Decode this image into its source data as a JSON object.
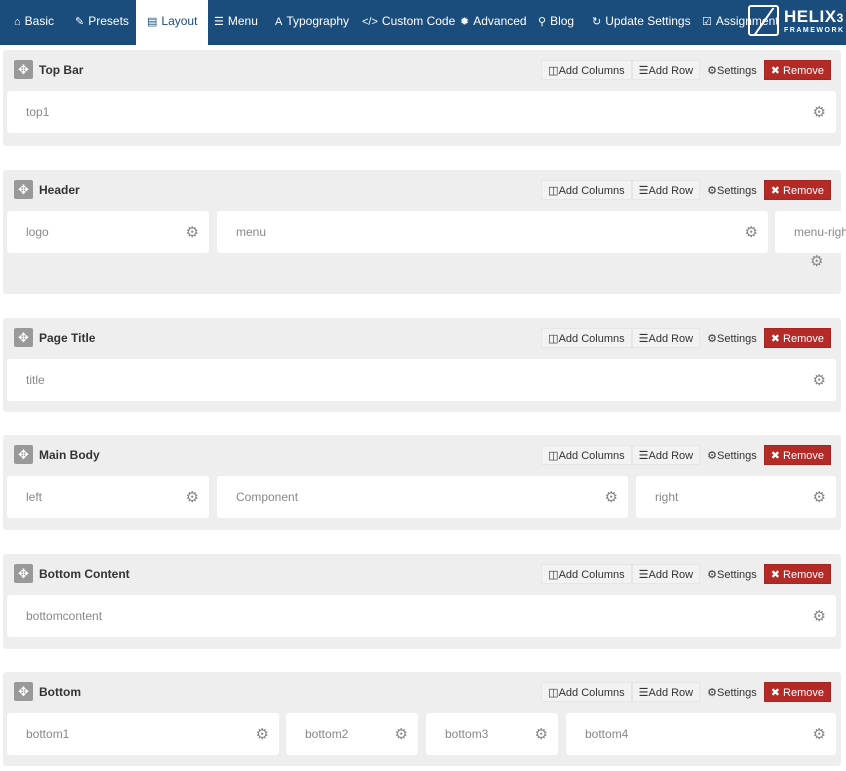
{
  "nav": {
    "tabs": [
      {
        "label": "Basic",
        "icon": "home-icon",
        "glyph": "⌂"
      },
      {
        "label": "Presets",
        "icon": "brush-icon",
        "glyph": "✎"
      },
      {
        "label": "Layout",
        "icon": "layout-icon",
        "glyph": "▤"
      },
      {
        "label": "Menu",
        "icon": "list-icon",
        "glyph": "☰"
      },
      {
        "label": "Typography",
        "icon": "font-icon",
        "glyph": "A"
      },
      {
        "label": "Custom Code",
        "icon": "code-icon",
        "glyph": "</>"
      },
      {
        "label": "Advanced",
        "icon": "cog-icon",
        "glyph": "✹"
      },
      {
        "label": "Blog",
        "icon": "pin-icon",
        "glyph": "⚲"
      },
      {
        "label": "Update Settings",
        "icon": "refresh-icon",
        "glyph": "↻"
      },
      {
        "label": "Assignment",
        "icon": "check-square-icon",
        "glyph": "☑"
      }
    ],
    "active": "Layout"
  },
  "logo": {
    "name": "HELIX",
    "version": "3",
    "sub": "FRAMEWORK"
  },
  "buttons": {
    "add_columns": "Add Columns",
    "add_row": "Add Row",
    "settings": "Settings",
    "remove": "Remove"
  },
  "sections": [
    {
      "title": "Top Bar",
      "columns": [
        "top1"
      ]
    },
    {
      "title": "Header",
      "columns": [
        "logo",
        "menu",
        "menu-right"
      ]
    },
    {
      "title": "Page Title",
      "columns": [
        "title"
      ]
    },
    {
      "title": "Main Body",
      "columns": [
        "left",
        "Component",
        "right"
      ]
    },
    {
      "title": "Bottom Content",
      "columns": [
        "bottomcontent"
      ]
    },
    {
      "title": "Bottom",
      "columns": [
        "bottom1",
        "bottom2",
        "bottom3",
        "bottom4"
      ]
    }
  ]
}
